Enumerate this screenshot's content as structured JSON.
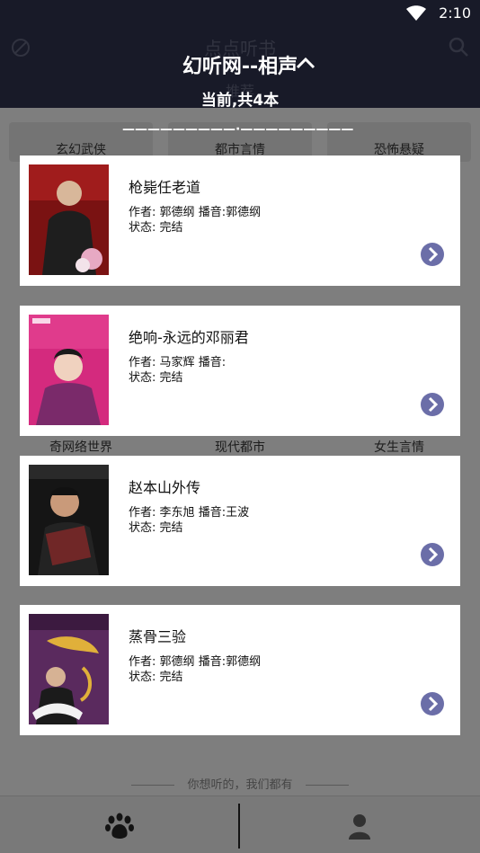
{
  "status_bar": {
    "time": "2:10"
  },
  "background": {
    "app_title": "点点听书",
    "subtitle": "推荐",
    "categories_row1": [
      "玄幻武侠",
      "都市言情",
      "恐怖悬疑"
    ],
    "categories_row2": [
      "奇网络世界",
      "现代都市",
      "女生言情"
    ],
    "footer_note": "你想听的，我们都有"
  },
  "popup": {
    "title": "幻听网--相声",
    "count_text": "当前,共4本",
    "separator": "—————————·—————————",
    "author_label": "作者:",
    "narrator_label": "播音:",
    "status_label": "状态:",
    "books": [
      {
        "title": "枪毙任老道",
        "author": "郭德纲",
        "narrator": "郭德纲",
        "status": "完结"
      },
      {
        "title": "绝响-永远的邓丽君",
        "author": "马家辉",
        "narrator": "",
        "status": "完结"
      },
      {
        "title": "赵本山外传",
        "author": "李东旭",
        "narrator": "王波",
        "status": "完结"
      },
      {
        "title": "蒸骨三验",
        "author": "郭德纲",
        "narrator": "郭德纲",
        "status": "完结"
      }
    ]
  },
  "colors": {
    "header": "#2a2d45",
    "accent": "#6b6ea8"
  }
}
